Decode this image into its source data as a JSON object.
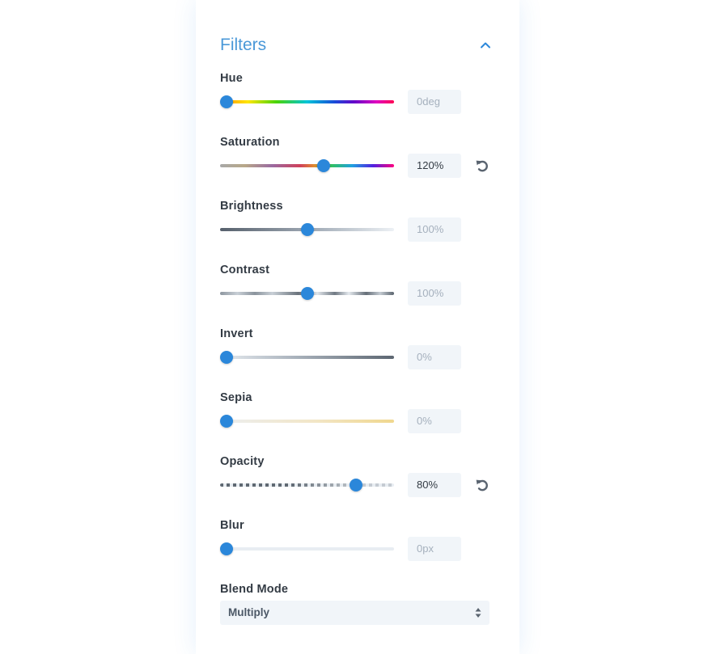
{
  "panel": {
    "title": "Filters",
    "collapse_icon": "chevron-up-icon"
  },
  "accent_color": "#2b87da",
  "title_color": "#4a98d8",
  "filters": {
    "hue": {
      "label": "Hue",
      "value": "0deg",
      "level": 0.0,
      "changed": false
    },
    "saturation": {
      "label": "Saturation",
      "value": "120%",
      "level": 0.6,
      "changed": true,
      "reset_icon": "undo-icon"
    },
    "brightness": {
      "label": "Brightness",
      "value": "100%",
      "level": 0.5,
      "changed": false
    },
    "contrast": {
      "label": "Contrast",
      "value": "100%",
      "level": 0.5,
      "changed": false
    },
    "invert": {
      "label": "Invert",
      "value": "0%",
      "level": 0.0,
      "changed": false
    },
    "sepia": {
      "label": "Sepia",
      "value": "0%",
      "level": 0.0,
      "changed": false
    },
    "opacity": {
      "label": "Opacity",
      "value": "80%",
      "level": 0.8,
      "changed": true,
      "reset_icon": "undo-icon"
    },
    "blur": {
      "label": "Blur",
      "value": "0px",
      "level": 0.0,
      "changed": false
    }
  },
  "blend_mode": {
    "label": "Blend Mode",
    "selected": "Multiply"
  }
}
